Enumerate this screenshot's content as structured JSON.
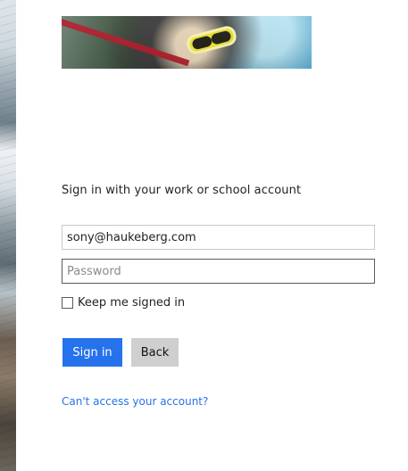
{
  "auth": {
    "heading": "Sign in with your work or school account",
    "email": {
      "value": "sony@haukeberg.com",
      "placeholder": ""
    },
    "password": {
      "value": "",
      "placeholder": "Password"
    },
    "keep_signed_in_label": "Keep me signed in",
    "keep_signed_in_checked": false,
    "signin_label": "Sign in",
    "back_label": "Back",
    "cant_access_link": "Can't access your account?"
  },
  "theme": {
    "accent": "#2672ec",
    "button_secondary": "#cfcfcf"
  }
}
